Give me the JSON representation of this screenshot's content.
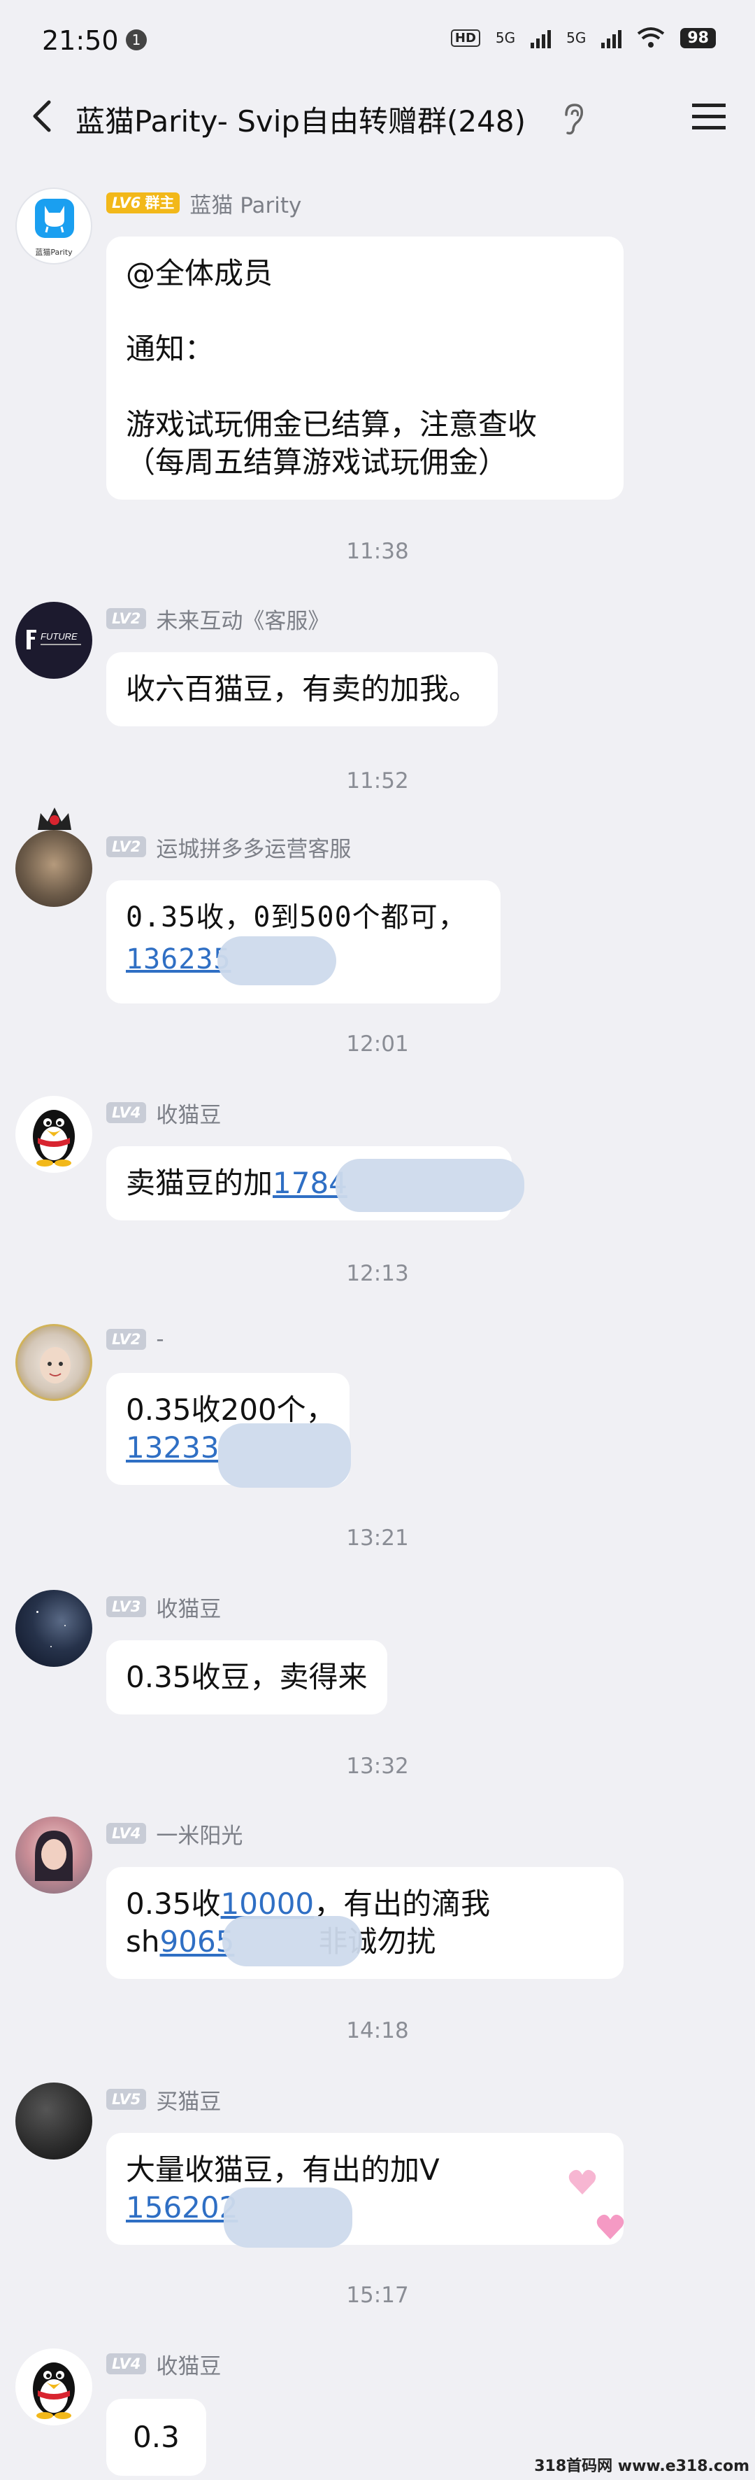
{
  "status": {
    "time": "21:50",
    "notif_count": "1",
    "hd": "HD",
    "net1": "5G",
    "net2": "5G",
    "battery": "98"
  },
  "header": {
    "title": "蓝猫Parity- Svip自由转赠群(248)"
  },
  "messages": [
    {
      "level": "LV6",
      "role": "群主",
      "sender": "蓝猫 Parity",
      "lines": [
        "@全体成员",
        "",
        "通知：",
        "",
        "游戏试玩佣金已结算，注意查收",
        "（每周五结算游戏试玩佣金）"
      ],
      "avatar_label": "蓝猫Parity"
    },
    {
      "time": "11:38",
      "level": "LV2",
      "sender": "未来互动《客服》",
      "text": "收六百猫豆，有卖的加我。",
      "avatar_label": "FUTURE"
    },
    {
      "time": "11:52",
      "level": "LV2",
      "sender": "运城拼多多运营客服",
      "line1": "0.35收，0到500个都可，",
      "link": "136235"
    },
    {
      "time": "12:01",
      "level": "LV4",
      "sender": "收猫豆",
      "text": "卖猫豆的加",
      "link": "1784"
    },
    {
      "time": "12:13",
      "level": "LV2",
      "sender": "-",
      "line1": "0.35收200个，",
      "link": "13233"
    },
    {
      "time": "13:21",
      "level": "LV3",
      "sender": "收猫豆",
      "text": "0.35收豆，卖得来"
    },
    {
      "time": "13:32",
      "level": "LV4",
      "sender": "一米阳光",
      "line1_pre": "0.35收",
      "line1_link": "10000",
      "line1_post": "，有出的滴我",
      "line2_pre": "sh",
      "line2_link": "9065",
      "line2_post": "非诚勿扰"
    },
    {
      "time": "14:18",
      "level": "LV5",
      "sender": "买猫豆",
      "line1": "大量收猫豆，有出的加V",
      "link": "156202"
    },
    {
      "time": "15:17",
      "level": "LV4",
      "sender": "收猫豆",
      "text": "0.3"
    }
  ],
  "watermark": "318首码网 www.e318.com",
  "colors": {
    "link": "#2f6fc4",
    "owner_badge": "#f2b81a",
    "background": "#f0f0f4"
  }
}
